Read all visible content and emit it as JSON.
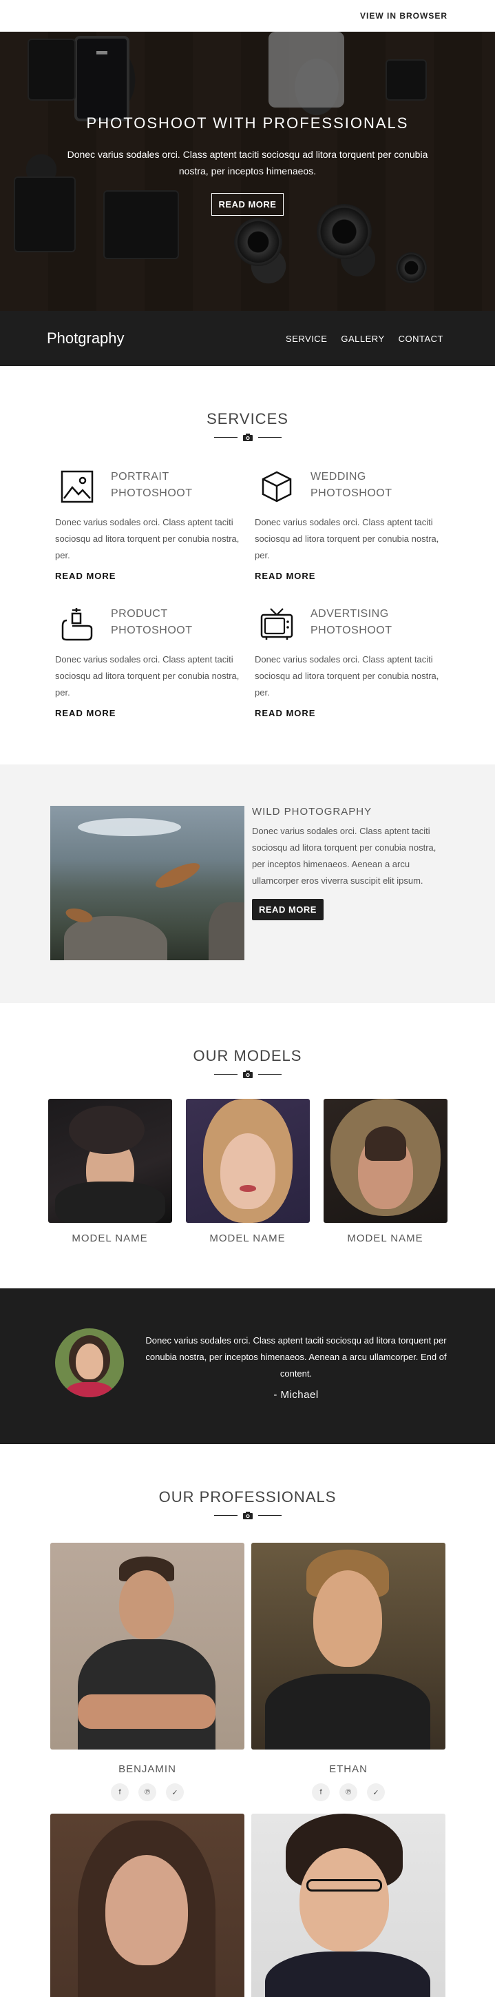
{
  "topbar": {
    "view_in_browser": "VIEW IN BROWSER"
  },
  "hero": {
    "title": "PHOTOSHOOT WITH PROFESSIONALS",
    "text": "Donec varius sodales orci. Class aptent taciti sociosqu ad litora torquent per conubia nostra, per inceptos himenaeos.",
    "button": "READ MORE"
  },
  "nav": {
    "brand": "Photgraphy",
    "links": [
      "SERVICE",
      "GALLERY",
      "CONTACT"
    ]
  },
  "services": {
    "heading": "SERVICES",
    "items": [
      {
        "title": "PORTRAIT PHOTOSHOOT",
        "icon": "picture-icon",
        "text": "Donec varius sodales orci. Class aptent taciti sociosqu ad litora torquent per conubia nostra, per.",
        "more": "READ MORE"
      },
      {
        "title": "WEDDING PHOTOSHOOT",
        "icon": "cube-icon",
        "text": "Donec varius sodales orci. Class aptent taciti sociosqu ad litora torquent per conubia nostra, per.",
        "more": "READ MORE"
      },
      {
        "title": "PRODUCT PHOTOSHOOT",
        "icon": "perfume-icon",
        "text": "Donec varius sodales orci. Class aptent taciti sociosqu ad litora torquent per conubia nostra, per.",
        "more": "READ MORE"
      },
      {
        "title": "ADVERTISING PHOTOSHOOT",
        "icon": "tv-icon",
        "text": "Donec varius sodales orci. Class aptent taciti sociosqu ad litora torquent per conubia nostra, per.",
        "more": "READ MORE"
      }
    ]
  },
  "wild": {
    "title": "WILD PHOTOGRAPHY",
    "text": "Donec varius sodales orci. Class aptent taciti sociosqu ad litora torquent per conubia nostra, per inceptos himenaeos. Aenean a arcu ullamcorper eros viverra suscipit elit ipsum.",
    "button": "READ MORE"
  },
  "models": {
    "heading": "OUR MODELS",
    "items": [
      {
        "name": "MODEL NAME"
      },
      {
        "name": "MODEL NAME"
      },
      {
        "name": "MODEL NAME"
      }
    ]
  },
  "testimonial": {
    "text": "Donec varius sodales orci. Class aptent taciti sociosqu ad litora torquent per conubia nostra, per inceptos himenaeos. Aenean a arcu ullamcorper. End of content.",
    "author": "- Michael"
  },
  "professionals": {
    "heading": "OUR PROFESSIONALS",
    "items": [
      {
        "name": "BENJAMIN"
      },
      {
        "name": "ETHAN"
      }
    ],
    "socials": [
      "facebook-icon",
      "pinterest-icon",
      "twitter-icon"
    ]
  },
  "colors": {
    "dark": "#1e1e1e",
    "light_section": "#f3f3f3",
    "text": "#555555"
  }
}
